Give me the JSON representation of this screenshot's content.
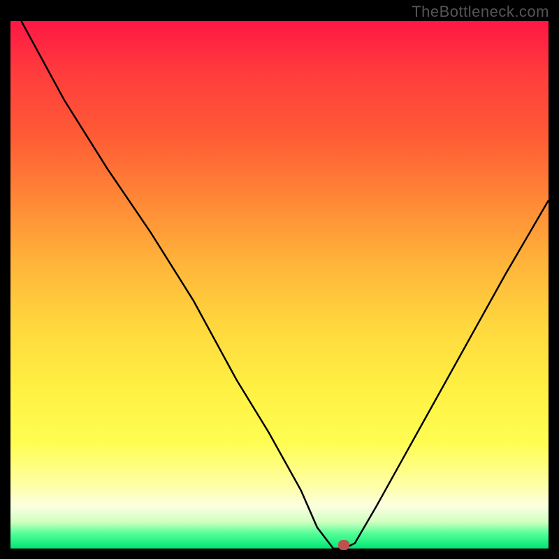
{
  "watermark": "TheBottleneck.com",
  "chart_data": {
    "type": "line",
    "title": "",
    "xlabel": "",
    "ylabel": "",
    "xlim": [
      0,
      100
    ],
    "ylim": [
      0,
      100
    ],
    "series": [
      {
        "name": "curve",
        "x": [
          2,
          10,
          18,
          26,
          34,
          42,
          48,
          54,
          57,
          60,
          62,
          64,
          68,
          74,
          80,
          86,
          92,
          100
        ],
        "y": [
          100,
          85,
          72,
          60,
          47,
          32,
          22,
          11,
          4,
          0,
          0,
          1,
          8,
          19,
          30,
          41,
          52,
          66
        ]
      }
    ],
    "marker": {
      "x": 62,
      "y": 0
    },
    "gradient_stops": [
      {
        "pos": 0,
        "color": "#ff1744"
      },
      {
        "pos": 50,
        "color": "#ffd83e"
      },
      {
        "pos": 90,
        "color": "#feffd0"
      },
      {
        "pos": 100,
        "color": "#00e676"
      }
    ]
  }
}
